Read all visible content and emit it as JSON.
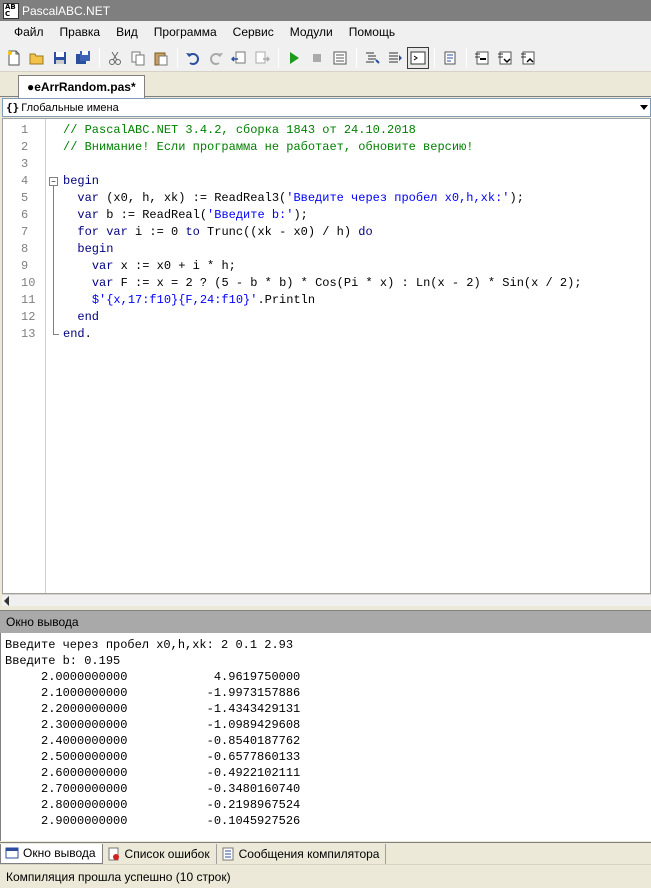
{
  "window": {
    "title": "PascalABC.NET"
  },
  "menu": [
    "Файл",
    "Правка",
    "Вид",
    "Программа",
    "Сервис",
    "Модули",
    "Помощь"
  ],
  "toolbar": {
    "buttons": [
      "new-file",
      "open-file",
      "save",
      "save-all",
      "cut",
      "copy",
      "paste",
      "undo",
      "redo",
      "navigate-back",
      "navigate-forward",
      "run",
      "stop",
      "compile",
      "format",
      "step",
      "output-window",
      "debug",
      "step-over",
      "step-into",
      "step-out"
    ]
  },
  "tab": {
    "label": "●eArrRandom.pas*"
  },
  "scope": {
    "icon": "{}",
    "label": "Глобальные имена"
  },
  "code": [
    {
      "ln": "1",
      "indent": "",
      "tokens": [
        [
          "cm",
          "// PascalABC.NET 3.4.2, сборка 1843 от 24.10.2018"
        ]
      ]
    },
    {
      "ln": "2",
      "indent": "",
      "tokens": [
        [
          "cm",
          "// Внимание! Если программа не работает, обновите версию!"
        ]
      ]
    },
    {
      "ln": "3",
      "indent": "",
      "tokens": []
    },
    {
      "ln": "4",
      "indent": "",
      "tokens": [
        [
          "kw",
          "begin"
        ]
      ]
    },
    {
      "ln": "5",
      "indent": "  ",
      "tokens": [
        [
          "kw",
          "var"
        ],
        [
          "",
          " (x0, h, xk) := ReadReal3("
        ],
        [
          "st",
          "'Введите через пробел x0,h,xk:'"
        ],
        [
          "",
          ");"
        ]
      ]
    },
    {
      "ln": "6",
      "indent": "  ",
      "tokens": [
        [
          "kw",
          "var"
        ],
        [
          "",
          " b := ReadReal("
        ],
        [
          "st",
          "'Введите b:'"
        ],
        [
          "",
          ");"
        ]
      ]
    },
    {
      "ln": "7",
      "indent": "  ",
      "tokens": [
        [
          "kw",
          "for var"
        ],
        [
          "",
          " i := "
        ],
        [
          "num",
          "0"
        ],
        [
          "kw",
          " to"
        ],
        [
          "",
          " Trunc((xk - x0) / h) "
        ],
        [
          "kw",
          "do"
        ]
      ]
    },
    {
      "ln": "8",
      "indent": "  ",
      "tokens": [
        [
          "kw",
          "begin"
        ]
      ]
    },
    {
      "ln": "9",
      "indent": "    ",
      "tokens": [
        [
          "kw",
          "var"
        ],
        [
          "",
          " x := x0 + i * h;"
        ]
      ]
    },
    {
      "ln": "10",
      "indent": "    ",
      "tokens": [
        [
          "kw",
          "var"
        ],
        [
          "",
          " F := x = "
        ],
        [
          "num",
          "2"
        ],
        [
          "",
          " ? ("
        ],
        [
          "num",
          "5"
        ],
        [
          "",
          " - b * b) * Cos(Pi * x) : Ln(x - "
        ],
        [
          "num",
          "2"
        ],
        [
          "",
          ") * Sin(x / "
        ],
        [
          "num",
          "2"
        ],
        [
          "",
          ");"
        ]
      ]
    },
    {
      "ln": "11",
      "indent": "    ",
      "tokens": [
        [
          "st",
          "$'{x,17:f10}{F,24:f10}'"
        ],
        [
          "",
          ".Println"
        ]
      ]
    },
    {
      "ln": "12",
      "indent": "  ",
      "tokens": [
        [
          "kw",
          "end"
        ]
      ]
    },
    {
      "ln": "13",
      "indent": "",
      "tokens": [
        [
          "kw",
          "end"
        ],
        [
          "",
          "."
        ]
      ]
    }
  ],
  "output_panel": {
    "title": "Окно вывода",
    "lines": [
      "Введите через пробел x0,h,xk: 2 0.1 2.93",
      "Введите b: 0.195",
      "     2.0000000000            4.9619750000",
      "     2.1000000000           -1.9973157886",
      "     2.2000000000           -1.4343429131",
      "     2.3000000000           -1.0989429608",
      "     2.4000000000           -0.8540187762",
      "     2.5000000000           -0.6577860133",
      "     2.6000000000           -0.4922102111",
      "     2.7000000000           -0.3480160740",
      "     2.8000000000           -0.2198967524",
      "     2.9000000000           -0.1045927526"
    ]
  },
  "bottom_tabs": [
    {
      "label": "Окно вывода",
      "icon": "output-window-icon",
      "active": true
    },
    {
      "label": "Список ошибок",
      "icon": "error-list-icon",
      "active": false
    },
    {
      "label": "Сообщения компилятора",
      "icon": "compiler-messages-icon",
      "active": false
    }
  ],
  "status": {
    "text": "Компиляция прошла успешно (10 строк)"
  }
}
